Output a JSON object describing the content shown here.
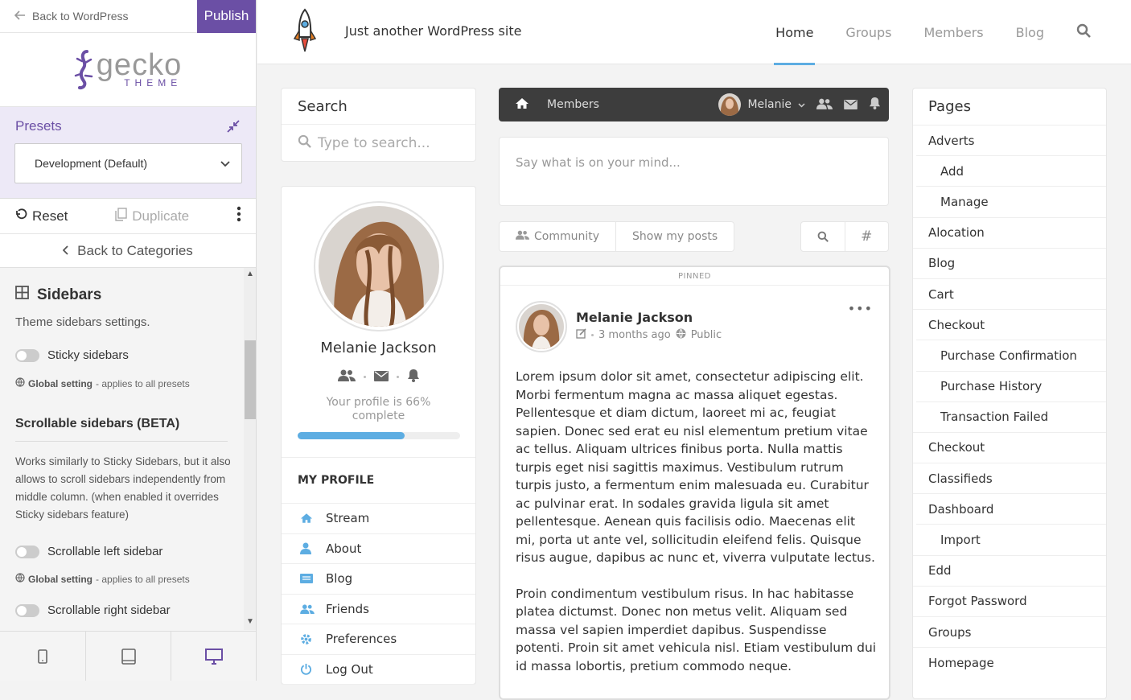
{
  "customizer": {
    "back_label": "Back to WordPress",
    "publish_label": "Publish",
    "logo": {
      "name": "gecko",
      "sub": "THEME"
    },
    "presets_label": "Presets",
    "preset_value": "Development (Default)",
    "reset_label": "Reset",
    "duplicate_label": "Duplicate",
    "back_categories_label": "Back to Categories",
    "section_title": "Sidebars",
    "section_desc": "Theme sidebars settings.",
    "sticky_label": "Sticky sidebars",
    "global_bold": "Global setting",
    "global_rest": " - applies to all presets",
    "scrollable_title": "Scrollable sidebars (BETA)",
    "scrollable_desc": "Works similarly to Sticky Sidebars, but it also allows to scroll sidebars independently from middle column. (when enabled it overrides Sticky sidebars feature)",
    "scroll_left_label": "Scrollable left sidebar",
    "scroll_right_label": "Scrollable right sidebar",
    "accent": "#6b4fa5"
  },
  "site": {
    "tagline": "Just another WordPress site",
    "nav": [
      "Home",
      "Groups",
      "Members",
      "Blog"
    ],
    "search_title": "Search",
    "search_placeholder": "Type to search...",
    "profile_name": "Melanie Jackson",
    "profile_complete_line1": "Your profile is 66%",
    "profile_complete_line2": "complete",
    "profile_progress": 0.66,
    "my_profile_label": "MY PROFILE",
    "menu": [
      {
        "label": "Stream",
        "icon": "home-icon"
      },
      {
        "label": "About",
        "icon": "user-icon"
      },
      {
        "label": "Blog",
        "icon": "blog-icon"
      },
      {
        "label": "Friends",
        "icon": "friends-icon"
      },
      {
        "label": "Preferences",
        "icon": "gear-icon"
      },
      {
        "label": "Log Out",
        "icon": "power-icon"
      }
    ],
    "members_label": "Members",
    "members_user": "Melanie",
    "post_placeholder": "Say what is on your mind...",
    "filter_community": "Community",
    "filter_myposts": "Show my posts",
    "pinned": "PINNED",
    "post_author": "Melanie Jackson",
    "post_time": "3 months ago",
    "post_visibility": "Public",
    "post_p1": "Lorem ipsum dolor sit amet, consectetur adipiscing elit. Morbi fermentum magna ac massa aliquet egestas. Pellentesque et diam dictum, laoreet mi ac, feugiat sapien. Donec sed erat eu nisl elementum pretium vitae ac tellus. Aliquam ultrices finibus porta. Nulla mattis turpis eget nisi sagittis maximus. Vestibulum rutrum turpis justo, a fermentum enim malesuada eu. Curabitur ac pulvinar erat. In sodales gravida ligula sit amet pellentesque. Aenean quis facilisis odio. Maecenas elit mi, porta ut ante vel, sollicitudin eleifend felis. Quisque risus augue, dapibus ac nunc et, viverra vulputate lectus.",
    "post_p2": "Proin condimentum vestibulum risus. In hac habitasse platea dictumst. Donec non metus velit. Aliquam sed massa vel sapien imperdiet dapibus. Suspendisse potenti. Proin sit amet vehicula nisl. Etiam vestibulum dui id massa lobortis, pretium commodo neque.",
    "pages_title": "Pages",
    "pages": [
      {
        "label": "Adverts",
        "child": false
      },
      {
        "label": "Add",
        "child": true
      },
      {
        "label": "Manage",
        "child": true
      },
      {
        "label": "Alocation",
        "child": false
      },
      {
        "label": "Blog",
        "child": false
      },
      {
        "label": "Cart",
        "child": false
      },
      {
        "label": "Checkout",
        "child": false
      },
      {
        "label": "Purchase Confirmation",
        "child": true
      },
      {
        "label": "Purchase History",
        "child": true
      },
      {
        "label": "Transaction Failed",
        "child": true
      },
      {
        "label": "Checkout",
        "child": false
      },
      {
        "label": "Classifieds",
        "child": false
      },
      {
        "label": "Dashboard",
        "child": false
      },
      {
        "label": "Import",
        "child": true
      },
      {
        "label": "Edd",
        "child": false
      },
      {
        "label": "Forgot Password",
        "child": false
      },
      {
        "label": "Groups",
        "child": false
      },
      {
        "label": "Homepage",
        "child": false
      }
    ],
    "accent": "#5dade2"
  }
}
